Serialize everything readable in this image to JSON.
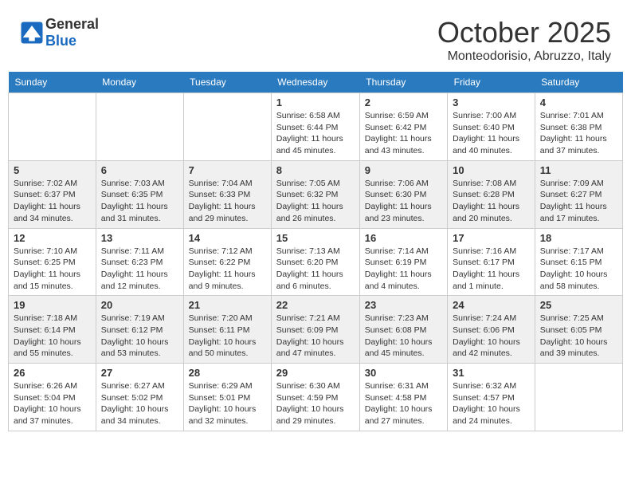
{
  "header": {
    "logo_general": "General",
    "logo_blue": "Blue",
    "month": "October 2025",
    "location": "Monteodorisio, Abruzzo, Italy"
  },
  "days_of_week": [
    "Sunday",
    "Monday",
    "Tuesday",
    "Wednesday",
    "Thursday",
    "Friday",
    "Saturday"
  ],
  "weeks": [
    [
      {
        "day": "",
        "info": ""
      },
      {
        "day": "",
        "info": ""
      },
      {
        "day": "",
        "info": ""
      },
      {
        "day": "1",
        "info": "Sunrise: 6:58 AM\nSunset: 6:44 PM\nDaylight: 11 hours and 45 minutes."
      },
      {
        "day": "2",
        "info": "Sunrise: 6:59 AM\nSunset: 6:42 PM\nDaylight: 11 hours and 43 minutes."
      },
      {
        "day": "3",
        "info": "Sunrise: 7:00 AM\nSunset: 6:40 PM\nDaylight: 11 hours and 40 minutes."
      },
      {
        "day": "4",
        "info": "Sunrise: 7:01 AM\nSunset: 6:38 PM\nDaylight: 11 hours and 37 minutes."
      }
    ],
    [
      {
        "day": "5",
        "info": "Sunrise: 7:02 AM\nSunset: 6:37 PM\nDaylight: 11 hours and 34 minutes."
      },
      {
        "day": "6",
        "info": "Sunrise: 7:03 AM\nSunset: 6:35 PM\nDaylight: 11 hours and 31 minutes."
      },
      {
        "day": "7",
        "info": "Sunrise: 7:04 AM\nSunset: 6:33 PM\nDaylight: 11 hours and 29 minutes."
      },
      {
        "day": "8",
        "info": "Sunrise: 7:05 AM\nSunset: 6:32 PM\nDaylight: 11 hours and 26 minutes."
      },
      {
        "day": "9",
        "info": "Sunrise: 7:06 AM\nSunset: 6:30 PM\nDaylight: 11 hours and 23 minutes."
      },
      {
        "day": "10",
        "info": "Sunrise: 7:08 AM\nSunset: 6:28 PM\nDaylight: 11 hours and 20 minutes."
      },
      {
        "day": "11",
        "info": "Sunrise: 7:09 AM\nSunset: 6:27 PM\nDaylight: 11 hours and 17 minutes."
      }
    ],
    [
      {
        "day": "12",
        "info": "Sunrise: 7:10 AM\nSunset: 6:25 PM\nDaylight: 11 hours and 15 minutes."
      },
      {
        "day": "13",
        "info": "Sunrise: 7:11 AM\nSunset: 6:23 PM\nDaylight: 11 hours and 12 minutes."
      },
      {
        "day": "14",
        "info": "Sunrise: 7:12 AM\nSunset: 6:22 PM\nDaylight: 11 hours and 9 minutes."
      },
      {
        "day": "15",
        "info": "Sunrise: 7:13 AM\nSunset: 6:20 PM\nDaylight: 11 hours and 6 minutes."
      },
      {
        "day": "16",
        "info": "Sunrise: 7:14 AM\nSunset: 6:19 PM\nDaylight: 11 hours and 4 minutes."
      },
      {
        "day": "17",
        "info": "Sunrise: 7:16 AM\nSunset: 6:17 PM\nDaylight: 11 hours and 1 minute."
      },
      {
        "day": "18",
        "info": "Sunrise: 7:17 AM\nSunset: 6:15 PM\nDaylight: 10 hours and 58 minutes."
      }
    ],
    [
      {
        "day": "19",
        "info": "Sunrise: 7:18 AM\nSunset: 6:14 PM\nDaylight: 10 hours and 55 minutes."
      },
      {
        "day": "20",
        "info": "Sunrise: 7:19 AM\nSunset: 6:12 PM\nDaylight: 10 hours and 53 minutes."
      },
      {
        "day": "21",
        "info": "Sunrise: 7:20 AM\nSunset: 6:11 PM\nDaylight: 10 hours and 50 minutes."
      },
      {
        "day": "22",
        "info": "Sunrise: 7:21 AM\nSunset: 6:09 PM\nDaylight: 10 hours and 47 minutes."
      },
      {
        "day": "23",
        "info": "Sunrise: 7:23 AM\nSunset: 6:08 PM\nDaylight: 10 hours and 45 minutes."
      },
      {
        "day": "24",
        "info": "Sunrise: 7:24 AM\nSunset: 6:06 PM\nDaylight: 10 hours and 42 minutes."
      },
      {
        "day": "25",
        "info": "Sunrise: 7:25 AM\nSunset: 6:05 PM\nDaylight: 10 hours and 39 minutes."
      }
    ],
    [
      {
        "day": "26",
        "info": "Sunrise: 6:26 AM\nSunset: 5:04 PM\nDaylight: 10 hours and 37 minutes."
      },
      {
        "day": "27",
        "info": "Sunrise: 6:27 AM\nSunset: 5:02 PM\nDaylight: 10 hours and 34 minutes."
      },
      {
        "day": "28",
        "info": "Sunrise: 6:29 AM\nSunset: 5:01 PM\nDaylight: 10 hours and 32 minutes."
      },
      {
        "day": "29",
        "info": "Sunrise: 6:30 AM\nSunset: 4:59 PM\nDaylight: 10 hours and 29 minutes."
      },
      {
        "day": "30",
        "info": "Sunrise: 6:31 AM\nSunset: 4:58 PM\nDaylight: 10 hours and 27 minutes."
      },
      {
        "day": "31",
        "info": "Sunrise: 6:32 AM\nSunset: 4:57 PM\nDaylight: 10 hours and 24 minutes."
      },
      {
        "day": "",
        "info": ""
      }
    ]
  ]
}
